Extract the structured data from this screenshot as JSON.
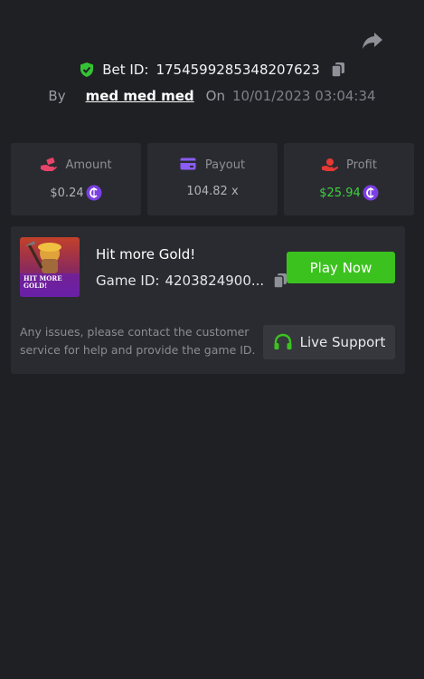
{
  "share": {
    "icon": "share-icon"
  },
  "bet": {
    "label": "Bet ID:",
    "id": "1754599285348207623",
    "verified_icon": "shield-check-icon",
    "copy_icon": "copy-icon"
  },
  "meta": {
    "by_label": "By",
    "username": "med med med",
    "on_label": "On",
    "datetime": "10/01/2023 03:04:34"
  },
  "stats": [
    {
      "key": "amount",
      "label": "Amount",
      "value": "$0.24",
      "icon": "bet-hand-icon",
      "show_coin": true
    },
    {
      "key": "payout",
      "label": "Payout",
      "value": "104.82 x",
      "icon": "card-icon",
      "show_coin": false
    },
    {
      "key": "profit",
      "label": "Profit",
      "value": "$25.94",
      "icon": "profit-hand-icon",
      "show_coin": true
    }
  ],
  "game": {
    "title": "Hit more Gold!",
    "id_label": "Game ID:",
    "id_value": "4203824900...",
    "thumb_text_line1": "HIT MORE",
    "thumb_text_line2": "GOLD!",
    "play_label": "Play Now"
  },
  "support": {
    "help_text": "Any issues, please contact the customer service for help and provide the game ID.",
    "button_label": "Live Support"
  },
  "colors": {
    "background": "#1f2024",
    "card": "#2a2b30",
    "accent_green": "#3cc21f",
    "profit_green": "#3cd23c",
    "coin_purple": "#7b3fe4",
    "amount_icon": "#e8446a",
    "payout_icon": "#8b5cf6",
    "profit_icon": "#e53935"
  }
}
